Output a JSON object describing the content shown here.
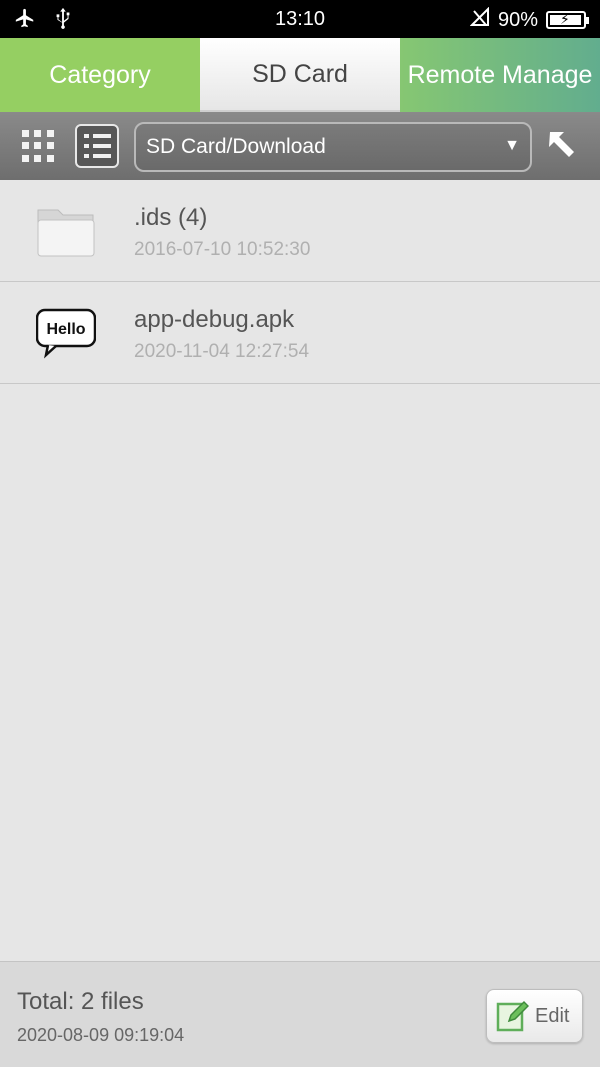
{
  "status_bar": {
    "time": "13:10",
    "battery_percent": "90%",
    "battery_level": 0.9,
    "icons": [
      "airplane-icon",
      "usb-icon",
      "no-signal-icon",
      "battery-charging-icon"
    ]
  },
  "tabs": [
    {
      "label": "Category",
      "active": false
    },
    {
      "label": "SD Card",
      "active": true
    },
    {
      "label": "Remote Manage",
      "active": false
    }
  ],
  "toolbar": {
    "path": "SD Card/Download",
    "icons": [
      "grid-view-icon",
      "list-view-icon",
      "dropdown-arrow-icon",
      "up-arrow-icon"
    ]
  },
  "files": [
    {
      "name": ".ids (4)",
      "date": "2016-07-10 10:52:30",
      "icon": "folder-icon"
    },
    {
      "name": "app-debug.apk",
      "date": "2020-11-04 12:27:54",
      "icon": "apk-hello-icon",
      "icon_text": "Hello"
    }
  ],
  "footer": {
    "total": "Total: 2 files",
    "date": "2020-08-09 09:19:04",
    "edit_label": "Edit"
  },
  "colors": {
    "tab_category": "#95cf62",
    "tab_remote": "#62ad8e",
    "toolbar": "#777777",
    "background": "#e6e6e6"
  }
}
